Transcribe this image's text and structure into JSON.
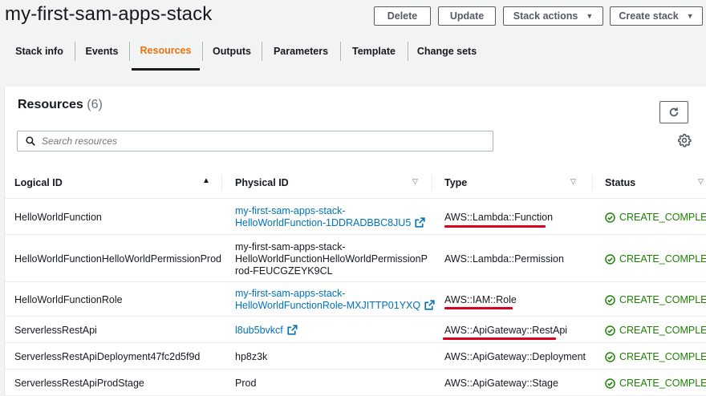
{
  "stack": {
    "title": "my-first-sam-apps-stack"
  },
  "actions": {
    "delete": "Delete",
    "update": "Update",
    "stack_actions": "Stack actions",
    "create_stack": "Create stack"
  },
  "tabs": [
    {
      "label": "Stack info"
    },
    {
      "label": "Events"
    },
    {
      "label": "Resources"
    },
    {
      "label": "Outputs"
    },
    {
      "label": "Parameters"
    },
    {
      "label": "Template"
    },
    {
      "label": "Change sets"
    }
  ],
  "active_tab": "Resources",
  "resources": {
    "heading": "Resources",
    "count": "(6)",
    "search_placeholder": "Search resources",
    "columns": {
      "logical_id": "Logical ID",
      "physical_id": "Physical ID",
      "type": "Type",
      "status": "Status"
    },
    "rows": [
      {
        "logical_id": "HelloWorldFunction",
        "physical_id": [
          "my-first-sam-apps-stack-",
          "HelloWorldFunction-1DDRADBBC8JU5"
        ],
        "physical_is_link": true,
        "type": "AWS::Lambda::Function",
        "type_highlighted": true,
        "status": "CREATE_COMPLETE"
      },
      {
        "logical_id": "HelloWorldFunctionHelloWorldPermissionProd",
        "physical_id": [
          "my-first-sam-apps-stack-",
          "HelloWorldFunctionHelloWorldPermissionP",
          "rod-FEUCGZEYK9CL"
        ],
        "physical_is_link": false,
        "type": "AWS::Lambda::Permission",
        "type_highlighted": false,
        "status": "CREATE_COMPLETE"
      },
      {
        "logical_id": "HelloWorldFunctionRole",
        "physical_id": [
          "my-first-sam-apps-stack-",
          "HelloWorldFunctionRole-MXJITTP01YXQ"
        ],
        "physical_is_link": true,
        "type": "AWS::IAM::Role",
        "type_highlighted": true,
        "status": "CREATE_COMPLETE"
      },
      {
        "logical_id": "ServerlessRestApi",
        "physical_id": [
          "l8ub5bvkcf"
        ],
        "physical_is_link": true,
        "type": "AWS::ApiGateway::RestApi",
        "type_highlighted": true,
        "status": "CREATE_COMPLETE"
      },
      {
        "logical_id": "ServerlessRestApiDeployment47fc2d5f9d",
        "physical_id": [
          "hp8z3k"
        ],
        "physical_is_link": false,
        "type": "AWS::ApiGateway::Deployment",
        "type_highlighted": false,
        "status": "CREATE_COMPLETE"
      },
      {
        "logical_id": "ServerlessRestApiProdStage",
        "physical_id": [
          "Prod"
        ],
        "physical_is_link": false,
        "type": "AWS::ApiGateway::Stage",
        "type_highlighted": false,
        "status": "CREATE_COMPLETE"
      }
    ]
  },
  "colors": {
    "active_tab": "#ec7211",
    "link": "#0073bb",
    "status_success": "#1d8102",
    "highlight_underline": "#d9001b"
  },
  "icons": {
    "refresh": "refresh-icon",
    "search": "search-icon",
    "settings": "gear-icon",
    "external_link": "external-link-icon",
    "status_success": "check-circle-icon",
    "sort_asc": "sort-ascending-icon",
    "sort": "sort-icon"
  }
}
